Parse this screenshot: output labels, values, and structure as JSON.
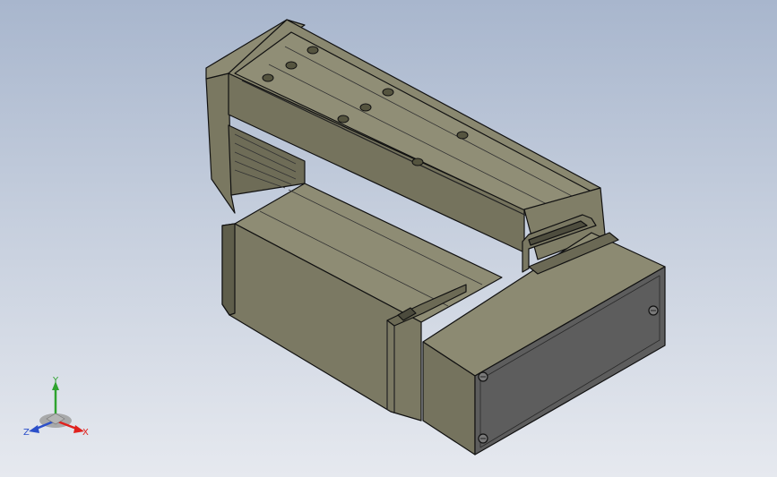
{
  "viewport": {
    "background_top": "#a8b6cd",
    "background_bottom": "#e6e9ef"
  },
  "model": {
    "body_color": "#7e7c64",
    "dark_face_color": "#5b5a47",
    "light_face_color": "#9c9a82",
    "end_plate_color": "#5d5d5d",
    "edge_color": "#111111"
  },
  "triad": {
    "x_label": "X",
    "y_label": "Y",
    "z_label": "Z",
    "x_color": "#e0211d",
    "y_color": "#2fa32f",
    "z_color": "#2b4fc9"
  }
}
